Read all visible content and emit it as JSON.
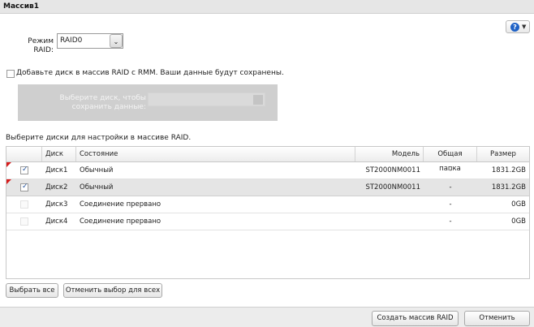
{
  "window": {
    "title": "Массив1"
  },
  "help": {
    "icon": "help-icon",
    "symbol": "?"
  },
  "mode": {
    "label": "Режим RAID:",
    "selected": "RAID0"
  },
  "rmm": {
    "checkbox_label": "Добавьте диск в массив RAID с RMM. Ваши данные будут сохранены.",
    "checked": false,
    "select_placeholder": "Выберите диск, чтобы сохранить данные:"
  },
  "disks": {
    "instruction": "Выберите диски для настройки в массиве RAID.",
    "columns": {
      "disk": "Диск",
      "state": "Состояние",
      "model": "Модель",
      "share": "Общая папка",
      "size": "Размер"
    },
    "rows": [
      {
        "checked": true,
        "enabled": true,
        "disk": "Диск1",
        "state": "Обычный",
        "model": "ST2000NM0011",
        "share": "-",
        "size": "1831.2GB"
      },
      {
        "checked": true,
        "enabled": true,
        "disk": "Диск2",
        "state": "Обычный",
        "model": "ST2000NM0011",
        "share": "-",
        "size": "1831.2GB"
      },
      {
        "checked": false,
        "enabled": false,
        "disk": "Диск3",
        "state": "Соединение прервано",
        "model": "",
        "share": "-",
        "size": "0GB"
      },
      {
        "checked": false,
        "enabled": false,
        "disk": "Диск4",
        "state": "Соединение прервано",
        "model": "",
        "share": "-",
        "size": "0GB"
      }
    ]
  },
  "buttons": {
    "select_all": "Выбрать все",
    "deselect_all": "Отменить выбор для всех",
    "create": "Создать массив RAID",
    "cancel": "Отменить"
  }
}
